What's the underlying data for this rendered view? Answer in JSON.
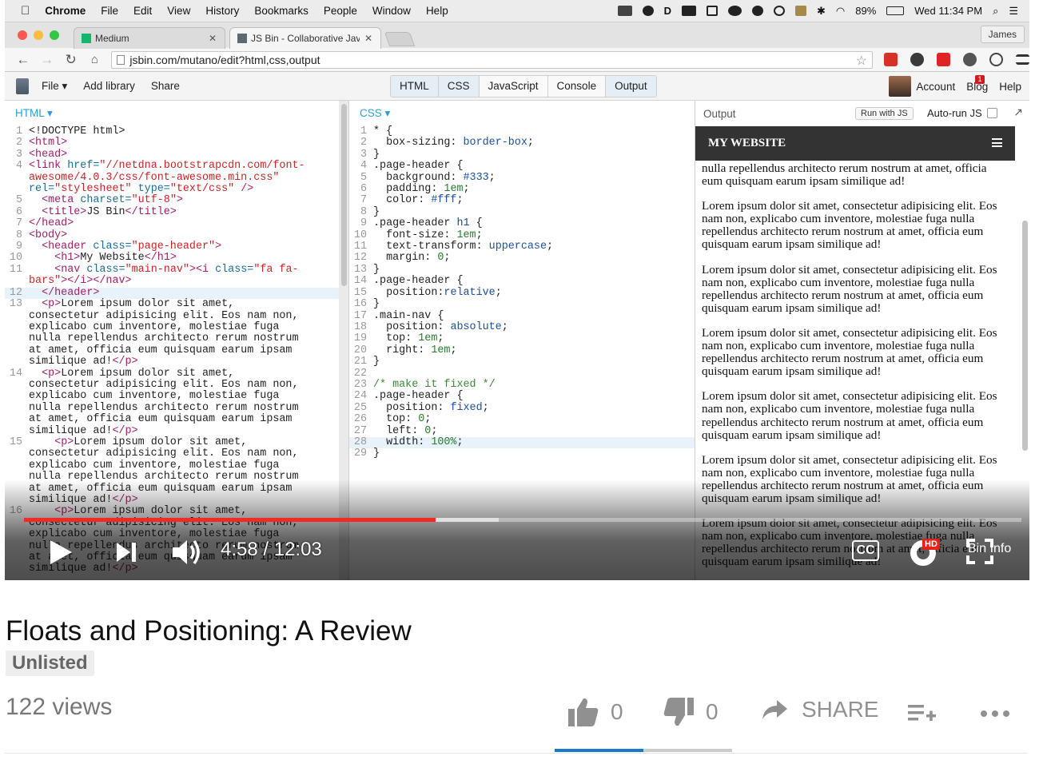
{
  "menubar": {
    "app": "Chrome",
    "items": [
      "File",
      "Edit",
      "View",
      "History",
      "Bookmarks",
      "People",
      "Window",
      "Help"
    ],
    "battery": "89%",
    "clock": "Wed 11:34 PM"
  },
  "browser": {
    "tabs": [
      {
        "label": "Medium"
      },
      {
        "label": "JS Bin - Collaborative Java"
      }
    ],
    "profile": "James",
    "url": "jsbin.com/mutano/edit?html,css,output"
  },
  "jsbin": {
    "menu": [
      "File",
      "Add library",
      "Share"
    ],
    "panels": [
      "HTML",
      "CSS",
      "JavaScript",
      "Console",
      "Output"
    ],
    "account": "Account",
    "blog": "Blog",
    "blog_badge": "1",
    "help": "Help"
  },
  "html_pane": {
    "label": "HTML ▾"
  },
  "css_pane": {
    "label": "CSS ▾"
  },
  "output_pane": {
    "label": "Output",
    "run_button": "Run with JS",
    "autorun": "Auto-run JS",
    "site_title": "My Website",
    "paragraph_partial": "nulla repellendus architecto rerum nostrum at amet, officia eum quisquam earum ipsam similique ad!",
    "paragraph": "Lorem ipsum dolor sit amet, consectetur adipisicing elit. Eos nam non, explicabo cum inventore, molestiae fuga nulla repellendus architecto rerum nostrum at amet, officia eum quisquam earum ipsam similique ad!"
  },
  "player": {
    "time": "4:58 / 12:03",
    "progress_fraction": 0.413,
    "buffered_fraction": 0.476,
    "cc": "CC",
    "hd": "HD",
    "overlay_text": "Bin Info"
  },
  "video": {
    "title": "Floats and Positioning: A Review",
    "visibility": "Unlisted",
    "views": "122 views",
    "likes": "0",
    "dislikes": "0",
    "share": "SHARE",
    "like_fraction": 0.5
  },
  "colors": {
    "progress": "#f12b24",
    "sentiment": "#167ac6",
    "jsbin_accent": "#2a9fd6"
  }
}
